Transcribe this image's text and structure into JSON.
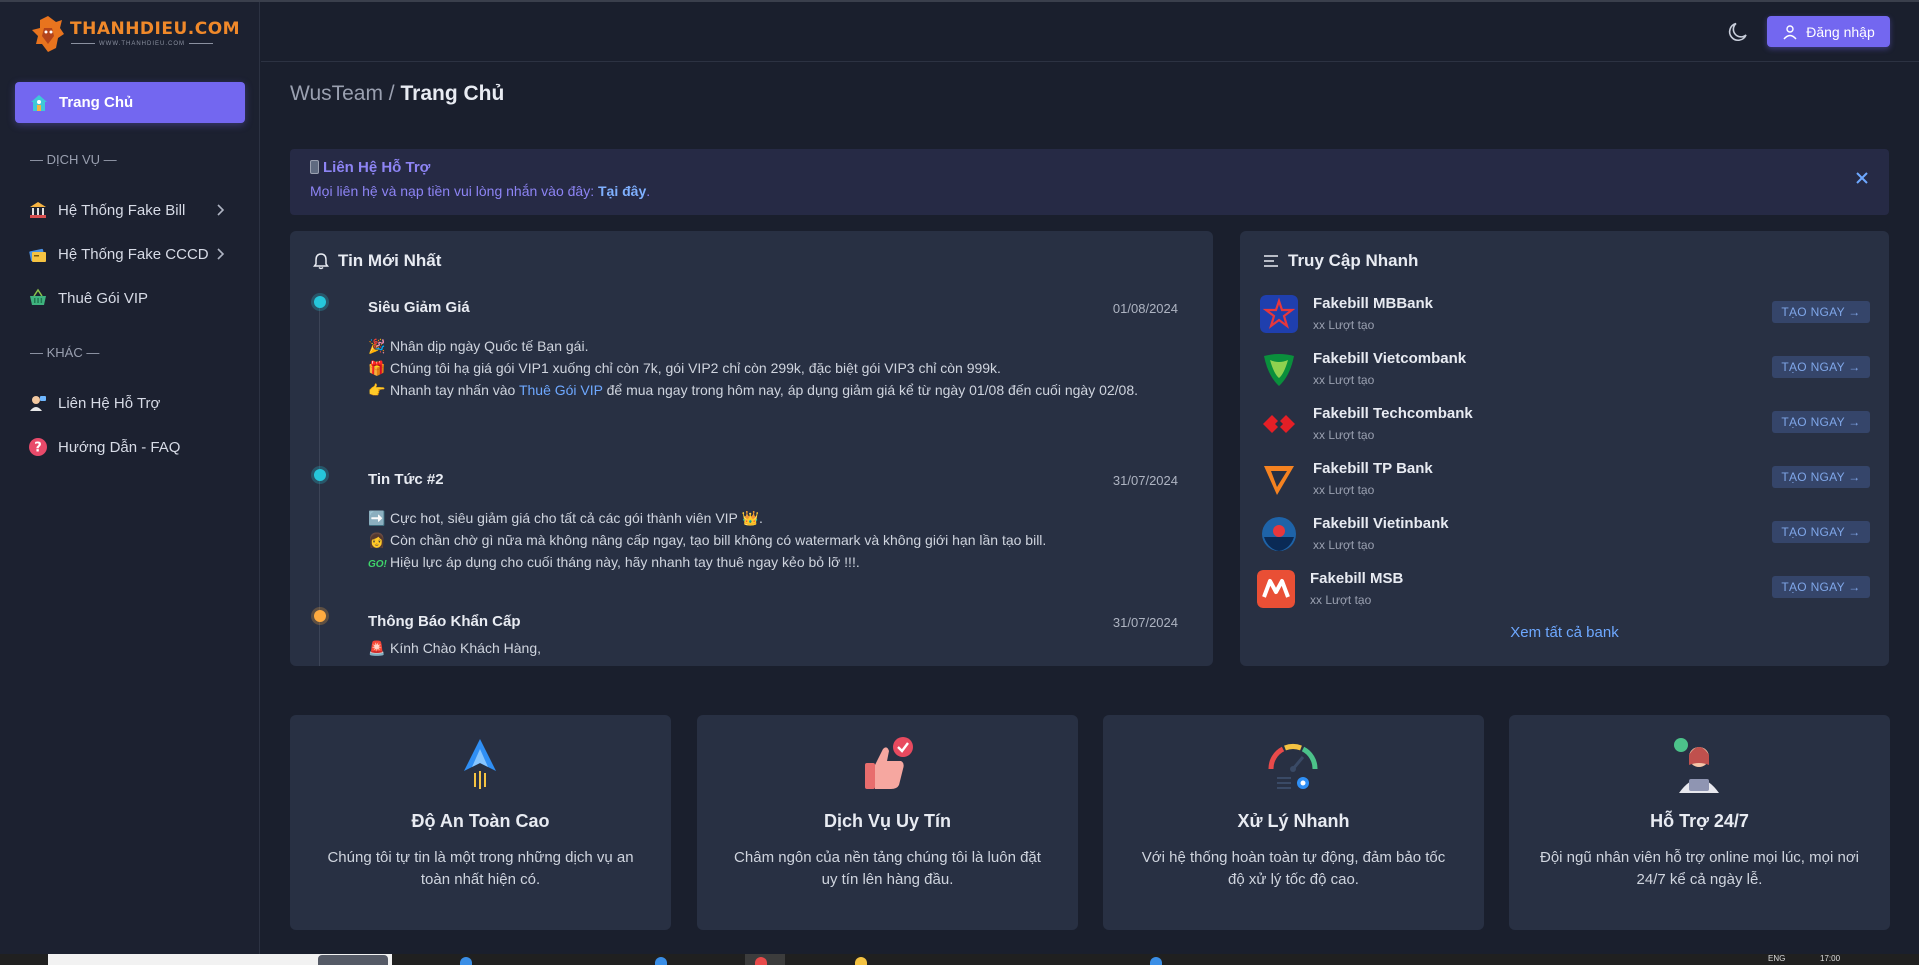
{
  "brand": {
    "name": "THANHDIEU.COM",
    "tagline": "WWW.THANHDIEU.COM"
  },
  "sidebar": {
    "home_label": "Trang Chủ",
    "section_services": "— DỊCH VỤ —",
    "section_other": "— KHÁC —",
    "items": [
      {
        "label": "Hệ Thống Fake Bill",
        "icon": "bank-icon"
      },
      {
        "label": "Hệ Thống Fake CCCD",
        "icon": "id-card-icon"
      },
      {
        "label": "Thuê Gói VIP",
        "icon": "basket-icon"
      },
      {
        "label": "Liên Hệ Hỗ Trợ",
        "icon": "support-agent-icon"
      },
      {
        "label": "Hướng Dẫn - FAQ",
        "icon": "question-icon"
      }
    ]
  },
  "header": {
    "login_label": "Đăng nhập"
  },
  "breadcrumb": {
    "root": "WusTeam / ",
    "current": "Trang Chủ"
  },
  "alert": {
    "title": "Liên Hệ Hỗ Trợ",
    "text": "Mọi liên hệ và nạp tiền vui lòng nhắn vào đây: ",
    "link": "Tại đây",
    "end": "."
  },
  "news": {
    "title": "Tin Mới Nhất",
    "items": [
      {
        "title": "Siêu Giảm Giá",
        "date": "01/08/2024",
        "lines": [
          "Nhân dịp ngày Quốc tế Bạn gái.",
          "Chúng tôi hạ giá gói VIP1 xuống chỉ còn 7k, gói VIP2 chỉ còn 299k, đặc biệt gói VIP3 chỉ còn 999k.",
          "Nhanh tay nhấn vào ",
          "Thuê Gói VIP",
          " để mua ngay trong hôm nay, áp dụng giảm giá kể từ ngày 01/08 đến cuối ngày 02/08."
        ]
      },
      {
        "title": "Tin Tức #2",
        "date": "31/07/2024",
        "lines": [
          "Cực hot, siêu giảm giá cho tất cả các gói thành viên VIP",
          "Còn chần chờ gì nữa mà không nâng cấp ngay, tạo bill không có watermark và không giới hạn lần tạo bill.",
          "Hiệu lực áp dụng cho cuối tháng này, hãy nhanh tay thuê ngay kẻo bỏ lỡ !!!."
        ]
      },
      {
        "title": "Thông Báo Khẩn Cấp",
        "date": "31/07/2024",
        "lines": [
          "Kính Chào Khách Hàng,"
        ]
      }
    ]
  },
  "quick": {
    "title": "Truy Cập Nhanh",
    "button_label": "TẠO NGAY →",
    "see_all": "Xem tất cả bank",
    "banks": [
      {
        "name": "Fakebill MBBank",
        "count": "xx Lượt tạo",
        "color": "#1f3fae"
      },
      {
        "name": "Fakebill Vietcombank",
        "count": "xx Lượt tạo",
        "color": "#0a8f3c"
      },
      {
        "name": "Fakebill Techcombank",
        "count": "xx Lượt tạo",
        "color": "#e41f26"
      },
      {
        "name": "Fakebill TP Bank",
        "count": "xx Lượt tạo",
        "color": "#f58220"
      },
      {
        "name": "Fakebill Vietinbank",
        "count": "xx Lượt tạo",
        "color": "#0a4f8f"
      },
      {
        "name": "Fakebill MSB",
        "count": "xx Lượt tạo",
        "color": "#e94f35"
      }
    ]
  },
  "features": [
    {
      "title": "Độ An Toàn Cao",
      "desc": "Chúng tôi tự tin là một trong những dịch vụ an toàn nhất hiện có."
    },
    {
      "title": "Dịch Vụ Uy Tín",
      "desc": "Châm ngôn của nền tảng chúng tôi là luôn đặt uy tín lên hàng đầu."
    },
    {
      "title": "Xử Lý Nhanh",
      "desc": "Với hệ thống hoàn toàn tự động, đảm bảo tốc độ xử lý tốc độ cao."
    },
    {
      "title": "Hỗ Trợ 24/7",
      "desc": "Đội ngũ nhân viên hỗ trợ online mọi lúc, mọi nơi 24/7 kể cả ngày lễ."
    }
  ],
  "taskbar": {
    "lang": "ENG",
    "time": "17:00"
  },
  "colors": {
    "accent": "#7367f0",
    "background": "#1a1f2d",
    "card": "#283043",
    "link": "#6ea8ff"
  }
}
